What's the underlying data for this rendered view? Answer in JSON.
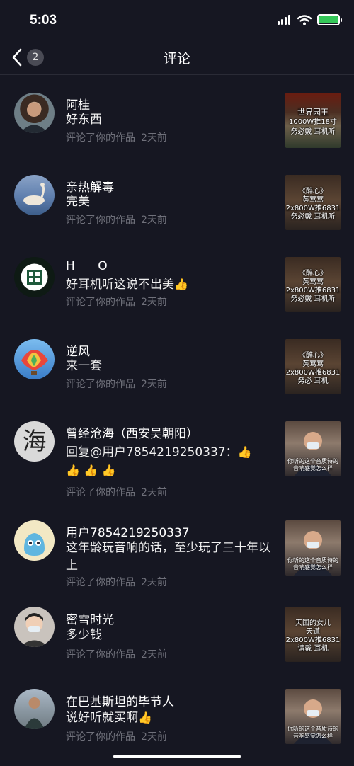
{
  "status_bar": {
    "time": "5:03"
  },
  "nav": {
    "title": "评论",
    "back_count": "2"
  },
  "thumb_texts": {
    "t1": [
      "世界园王",
      "1000W推18寸",
      "务必戴  耳机听"
    ],
    "t2": [
      "《醉心》",
      "黄莺莺",
      "2x800W推6831",
      "务必戴  耳机听"
    ],
    "t3": [
      "《醉心》",
      "黄莺莺",
      "2x800W推6831",
      "务必戴  耳机听"
    ],
    "t4": [
      "《醉心》",
      "黄莺莺",
      "2x800W推6831",
      "务必  耳机"
    ],
    "t5": [
      "你听的这个音质诗的",
      "音响感觉怎么样"
    ],
    "t6": [
      "你听的这个音质诗的",
      "音响感觉怎么样"
    ],
    "t7": [
      "天国的女儿",
      "天道",
      "2x800W推6831",
      "请戴    耳机"
    ],
    "t8": [
      "你听的这个音质诗的",
      "音响感觉怎么样"
    ]
  },
  "comments": [
    {
      "name": "阿桂",
      "text": "好东西",
      "action": "评论了你的作品",
      "time": "2天前"
    },
    {
      "name": "亲热解毒",
      "text": "完美",
      "action": "评论了你的作品",
      "time": "2天前"
    },
    {
      "name": "H      O",
      "text": "好耳机听这说不出美",
      "action": "评论了你的作品",
      "time": "2天前"
    },
    {
      "name": "逆风",
      "text": "来一套",
      "action": "评论了你的作品",
      "time": "2天前"
    },
    {
      "name": "曾经沧海（西安吴朝阳）",
      "text": "回复@用户7854219250337：",
      "action": "评论了你的作品",
      "time": "2天前"
    },
    {
      "name": "用户7854219250337",
      "text": "这年龄玩音响的话，至少玩了三十年以上",
      "action": "评论了你的作品",
      "time": "2天前"
    },
    {
      "name": "密雪时光",
      "text": "多少钱",
      "action": "评论了你的作品",
      "time": "2天前"
    },
    {
      "name": "在巴基斯坦的毕节人",
      "text": "说好听就买啊",
      "action": "评论了你的作品",
      "time": "2天前"
    }
  ],
  "colors": {
    "background": "#161722",
    "meta": "#6f707a",
    "battery": "#35c759"
  }
}
